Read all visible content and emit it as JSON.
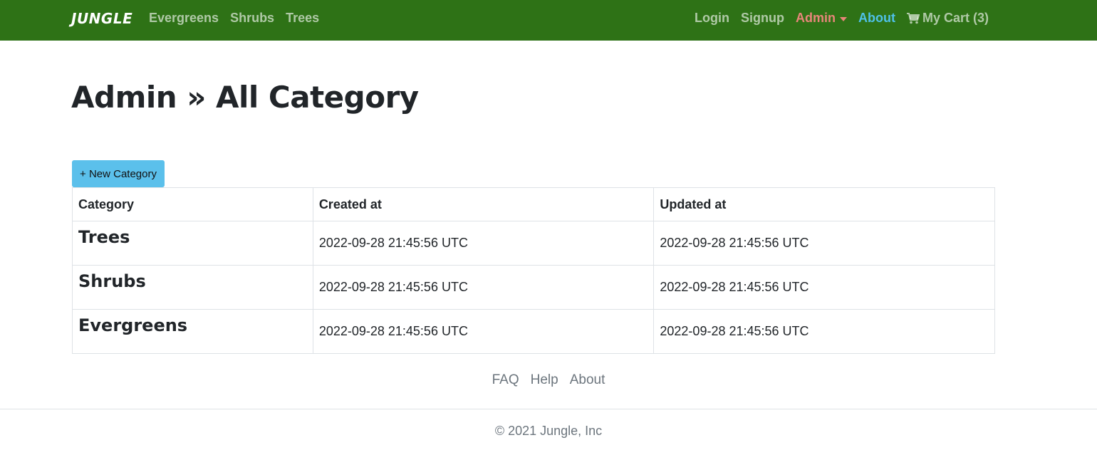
{
  "navbar": {
    "brand": "JUNGLE",
    "left_links": [
      "Evergreens",
      "Shrubs",
      "Trees"
    ],
    "login": "Login",
    "signup": "Signup",
    "admin": "Admin",
    "about": "About",
    "cart": "My Cart (3)",
    "colors": {
      "background": "#2e7216",
      "admin": "#e8867a",
      "about": "#4fc1e9"
    }
  },
  "main": {
    "title": "Admin » All Category",
    "new_button": "+ New Category",
    "table": {
      "headers": [
        "Category",
        "Created at",
        "Updated at"
      ],
      "rows": [
        {
          "category": "Trees",
          "created": "2022-09-28 21:45:56 UTC",
          "updated": "2022-09-28 21:45:56 UTC"
        },
        {
          "category": "Shrubs",
          "created": "2022-09-28 21:45:56 UTC",
          "updated": "2022-09-28 21:45:56 UTC"
        },
        {
          "category": "Evergreens",
          "created": "2022-09-28 21:45:56 UTC",
          "updated": "2022-09-28 21:45:56 UTC"
        }
      ]
    }
  },
  "footer": {
    "links": [
      "FAQ",
      "Help",
      "About"
    ],
    "copyright": "© 2021 Jungle, Inc"
  }
}
